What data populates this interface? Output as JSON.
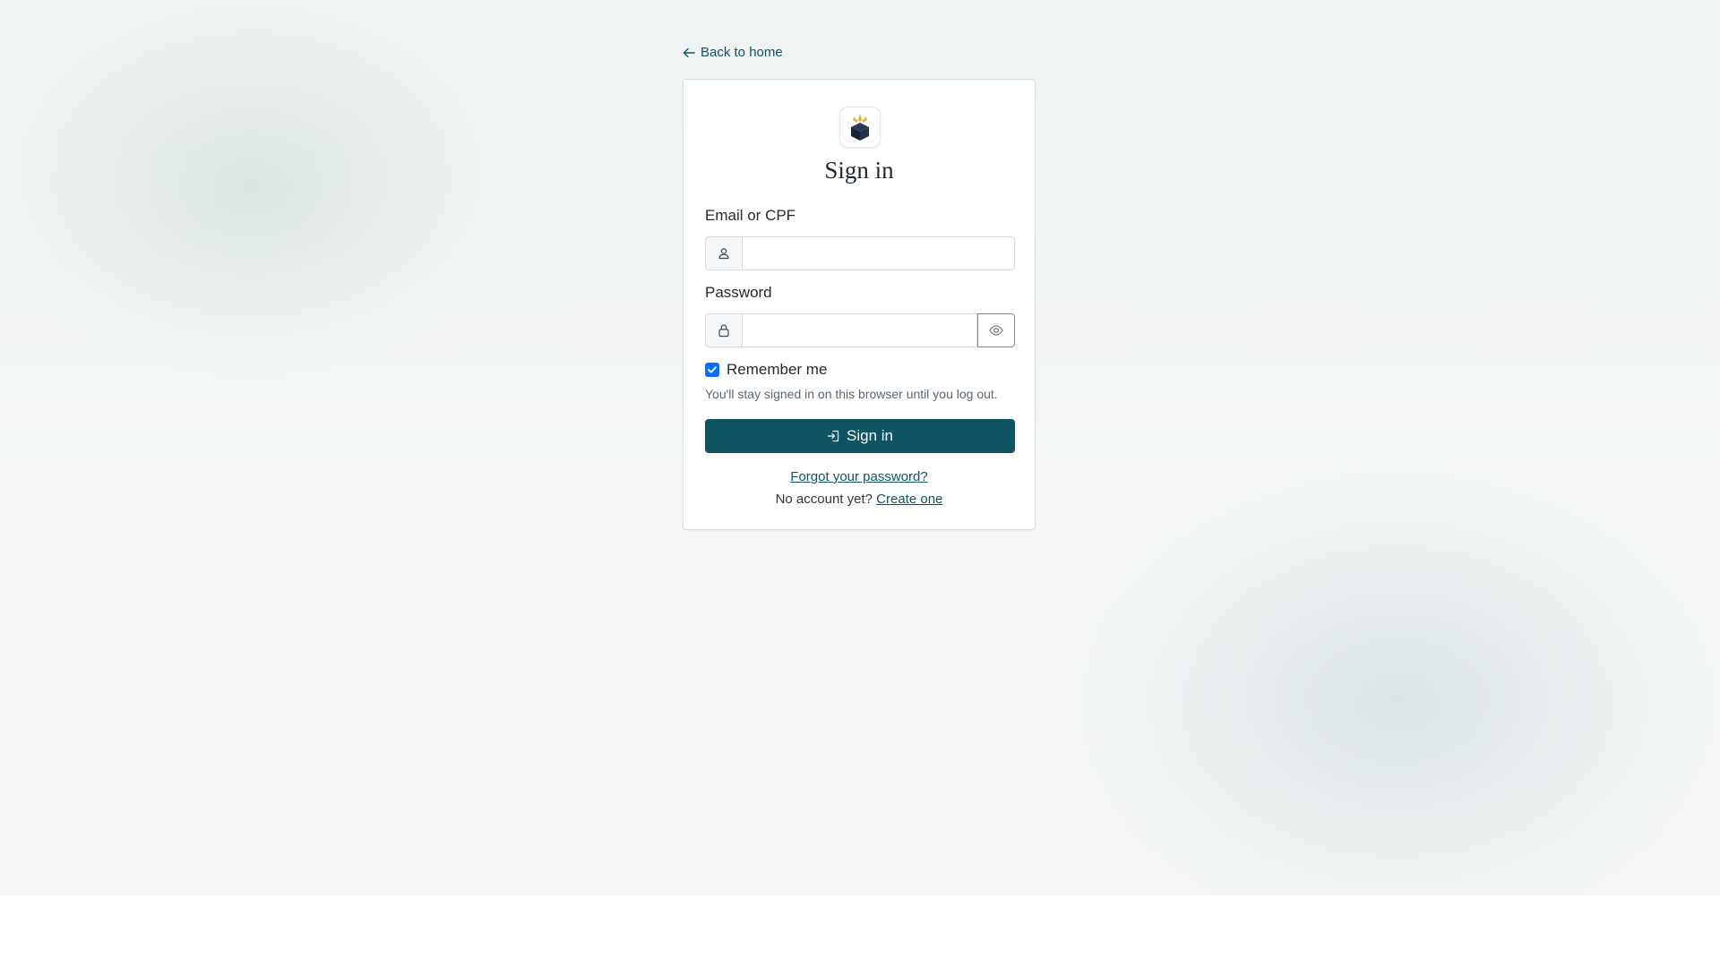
{
  "nav": {
    "back_label": "Back to home"
  },
  "header": {
    "title": "Sign in"
  },
  "form": {
    "email_label": "Email or CPF",
    "email_value": "",
    "email_placeholder": "",
    "password_label": "Password",
    "password_value": "",
    "password_placeholder": "",
    "remember_label": "Remember me",
    "remember_checked": true,
    "remember_hint": "You'll stay signed in on this browser until you log out.",
    "submit_label": "Sign in"
  },
  "links": {
    "forgot_label": "Forgot your password?",
    "no_account_text": "No account yet?",
    "create_label": "Create one"
  },
  "icons": {
    "back": "arrow-left-icon",
    "logo": "gold-box-logo",
    "email": "user-icon",
    "password": "lock-icon",
    "toggle": "eye-icon",
    "remember": "check-icon",
    "submit": "sign-in-icon"
  },
  "colors": {
    "primary": "#0f5561",
    "checkbox": "#0d6efd",
    "logo_dark": "#1a2233",
    "logo_gold": "#e7a92f"
  }
}
